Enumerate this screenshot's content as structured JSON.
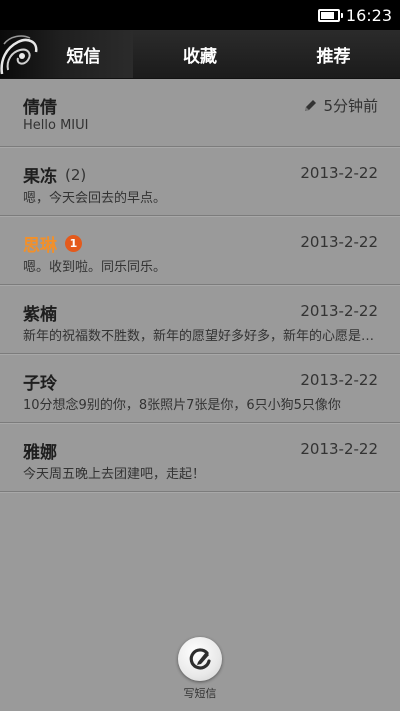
{
  "status_bar": {
    "time": "16:23",
    "battery_level": 0.85,
    "battery_icon": "battery-icon"
  },
  "tabs": [
    {
      "label": "短信",
      "active": true
    },
    {
      "label": "收藏",
      "active": false
    },
    {
      "label": "推荐",
      "active": false
    }
  ],
  "messages": [
    {
      "name": "倩倩",
      "count": "",
      "unread_count": "",
      "date": "5分钟前",
      "preview": "Hello MIUI",
      "draft_icon": "pencil-icon"
    },
    {
      "name": "果冻",
      "count": "(2)",
      "unread_count": "",
      "date": "2013-2-22",
      "preview": "嗯，今天会回去的早点。"
    },
    {
      "name": "思琳",
      "count": "",
      "unread_count": "1",
      "date": "2013-2-22",
      "preview": "嗯。收到啦。同乐同乐。"
    },
    {
      "name": "紫楠",
      "count": "",
      "unread_count": "",
      "date": "2013-2-22",
      "preview": "新年的祝福数不胜数，新年的愿望好多好多，新年的心愿是愿你快乐"
    },
    {
      "name": "子玲",
      "count": "",
      "unread_count": "",
      "date": "2013-2-22",
      "preview": "10分想念9别的你，8张照片7张是你，6只小狗5只像你"
    },
    {
      "name": "雅娜",
      "count": "",
      "unread_count": "",
      "date": "2013-2-22",
      "preview": "今天周五晚上去团建吧，走起！"
    }
  ],
  "compose": {
    "label": "写短信",
    "icon": "compose-icon"
  },
  "colors": {
    "background": "#9a9a9a",
    "tabbar": "#1f1f1f",
    "unread_name": "#f2902a",
    "unread_badge": "#e45a1c"
  }
}
